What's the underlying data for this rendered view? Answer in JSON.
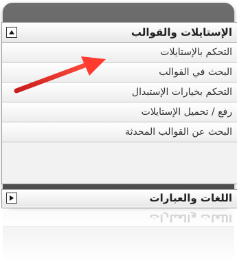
{
  "styles_panel": {
    "title": "الإستايلات والقوالب",
    "items": [
      {
        "label": "التحكم بالإستايلات"
      },
      {
        "label": "البحث في القوالب"
      },
      {
        "label": "التحكم بخيارات الإستبدال"
      },
      {
        "label": "رفع / تحميل الإستايلات"
      },
      {
        "label": "البحث عن القوالب المحدثة"
      }
    ],
    "expanded": true
  },
  "languages_panel": {
    "title": "اللغات والعبارات",
    "expanded": false
  },
  "colors": {
    "arrow": "#e23b2f",
    "panel_bg": "#f2f2f2",
    "frame": "#5a5a5a"
  }
}
